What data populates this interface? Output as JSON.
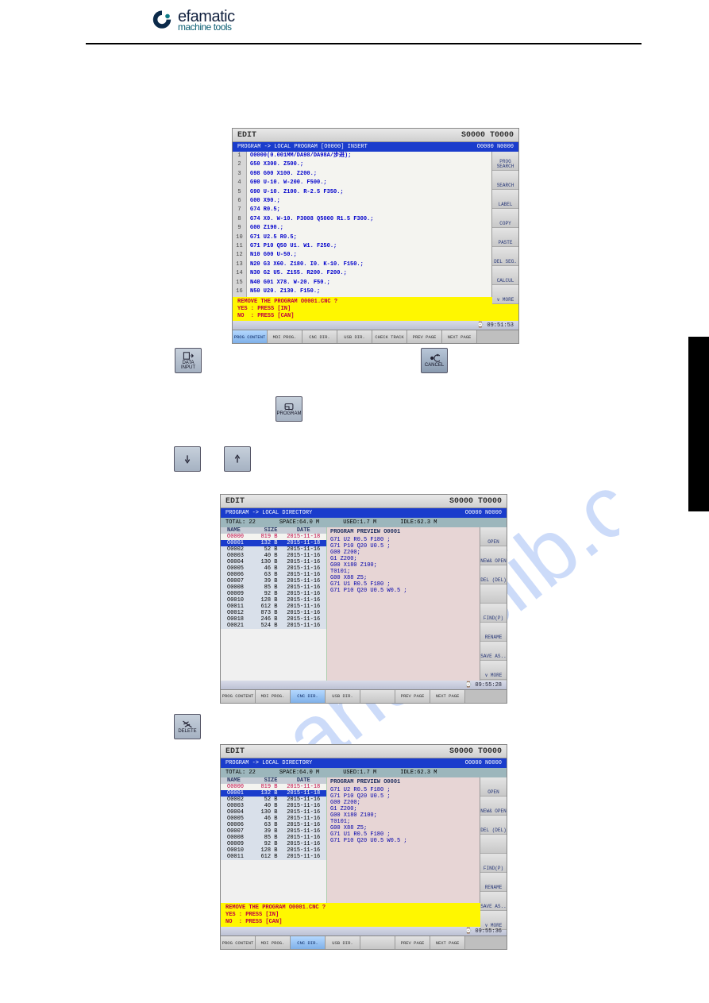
{
  "brand": {
    "name": "efamatic",
    "sub": "machine tools"
  },
  "screenshots": {
    "s1": {
      "title_left": "EDIT",
      "title_right": "S0000 T0000",
      "bar_left": "PROGRAM -> LOCAL PROGRAM [O0000]   INSERT",
      "bar_right": "O0000 N0000",
      "lines": [
        "1",
        "2",
        "3",
        "4",
        "5",
        "6",
        "7",
        "8",
        "9",
        "10",
        "11",
        "12",
        "13",
        "14",
        "15",
        "16"
      ],
      "code": "O0000(0.001MM/DA98/DA98A/步进);\nG50 X300. Z500.;\nG98 G00 X100. Z200.;\nG90 U-10. W-200. F500.;\nG90 U-10. Z100. R-2.5 F350.;\nG00 X90.;\nG74 R0.5;\nG74 X0. W-10. P3008 Q5000 R1.5 F300.;\nG00 Z190.;\nG71 U2.5 R0.5;\nG71 P10 Q50 U1. W1. F250.;\nN10 G00 U-50.;\nN20 G3 X60. Z180. I0. K-10. F150.;\nN30 G2 U5. Z155. R200. F200.;\nN40 G01 X78. W-20. F50.;\nN50 U20. Z130. F150.;",
      "yellow": "REMOVE THE PROGRAM O0001.CNC ?\nYES : PRESS [IN]\nNO  : PRESS [CAN]",
      "time": "⌚ 09:51:53",
      "right": [
        "PROG SEARCH",
        "SEARCH",
        "LABEL",
        "COPY",
        "PASTE",
        "DEL SEG.",
        "CALCUL",
        "∨ MORE"
      ],
      "bottom": [
        "PROG CONTENT",
        "MDI PROG.",
        "CNC DIR.",
        "USB DIR.",
        "CHECK TRACK",
        "PREV PAGE",
        "NEXT PAGE"
      ]
    },
    "s2": {
      "title_left": "EDIT",
      "title_right": "S0000 T0000",
      "bar_left": "PROGRAM -> LOCAL DIRECTORY",
      "bar_right": "O0000 N0000",
      "status": {
        "a": "TOTAL: 22",
        "b": "SPACE:64.0 M",
        "c": "USED:1.7 M",
        "d": "IDLE:62.3 M"
      },
      "head": {
        "n": "NAME",
        "s": "SIZE",
        "d": "DATE"
      },
      "rows": [
        {
          "n": "O0000",
          "s": "819 B",
          "d": "2015-11-18",
          "open": true
        },
        {
          "n": "O0001",
          "s": "132 B",
          "d": "2015-11-18",
          "sel": true
        },
        {
          "n": "O0002",
          "s": "52 B",
          "d": "2015-11-16"
        },
        {
          "n": "O0003",
          "s": "40 B",
          "d": "2015-11-16"
        },
        {
          "n": "O0004",
          "s": "130 B",
          "d": "2015-11-16"
        },
        {
          "n": "O0005",
          "s": "46 B",
          "d": "2015-11-16"
        },
        {
          "n": "O0006",
          "s": "63 B",
          "d": "2015-11-16"
        },
        {
          "n": "O0007",
          "s": "39 B",
          "d": "2015-11-16"
        },
        {
          "n": "O0008",
          "s": "85 B",
          "d": "2015-11-16"
        },
        {
          "n": "O0009",
          "s": "92 B",
          "d": "2015-11-16"
        },
        {
          "n": "O0010",
          "s": "128 B",
          "d": "2015-11-16"
        },
        {
          "n": "O0011",
          "s": "612 B",
          "d": "2015-11-16"
        },
        {
          "n": "O0012",
          "s": "873 B",
          "d": "2015-11-16"
        },
        {
          "n": "O0018",
          "s": "246 B",
          "d": "2015-11-16"
        },
        {
          "n": "O0021",
          "s": "524 B",
          "d": "2015-11-16"
        }
      ],
      "pvhead": "PROGRAM PREVIEW O0001",
      "preview": "G71 U2 R0.5 F180 ;\nG71 P10 Q20 U0.5 ;\nG00 Z200;\nG1 Z200;\nG00 X180 Z100;\nT0101;\nG00 X88 Z5;\nG71 U1 R0.5 F180 ;\nG71 P10 Q20 U0.5 W0.5 ;",
      "time": "⌚ 09:55:28",
      "right": [
        "OPEN",
        "NEW& OPEN",
        "DEL (DEL)",
        "",
        "FIND(P)",
        "RENAME",
        "SAVE AS..",
        "∨ MORE"
      ],
      "bottom": [
        "PROG CONTENT",
        "MDI PROG.",
        "CNC DIR.",
        "USB DIR.",
        "",
        "PREV PAGE",
        "NEXT PAGE"
      ]
    },
    "s3": {
      "title_left": "EDIT",
      "title_right": "S0000 T0000",
      "bar_left": "PROGRAM -> LOCAL DIRECTORY",
      "bar_right": "O0000 N0000",
      "status": {
        "a": "TOTAL: 22",
        "b": "SPACE:64.0 M",
        "c": "USED:1.7 M",
        "d": "IDLE:62.3 M"
      },
      "yellow": "REMOVE THE PROGRAM O0001.CNC ?\nYES : PRESS [IN]\nNO  : PRESS [CAN]",
      "time": "⌚ 09:55:36",
      "right": [
        "OPEN",
        "NEW& OPEN",
        "DEL (DEL)",
        "",
        "FIND(P)",
        "RENAME",
        "SAVE AS..",
        "∨ MORE"
      ],
      "bottom": [
        "PROG CONTENT",
        "MDI PROG.",
        "CNC DIR.",
        "USB DIR.",
        "",
        "PREV PAGE",
        "NEXT PAGE"
      ]
    }
  },
  "keys": {
    "in": "DATA\nINPUT",
    "cancel": "CANCEL",
    "program": "PROGRAM",
    "down": "",
    "up": "",
    "delete": "DELETE"
  }
}
